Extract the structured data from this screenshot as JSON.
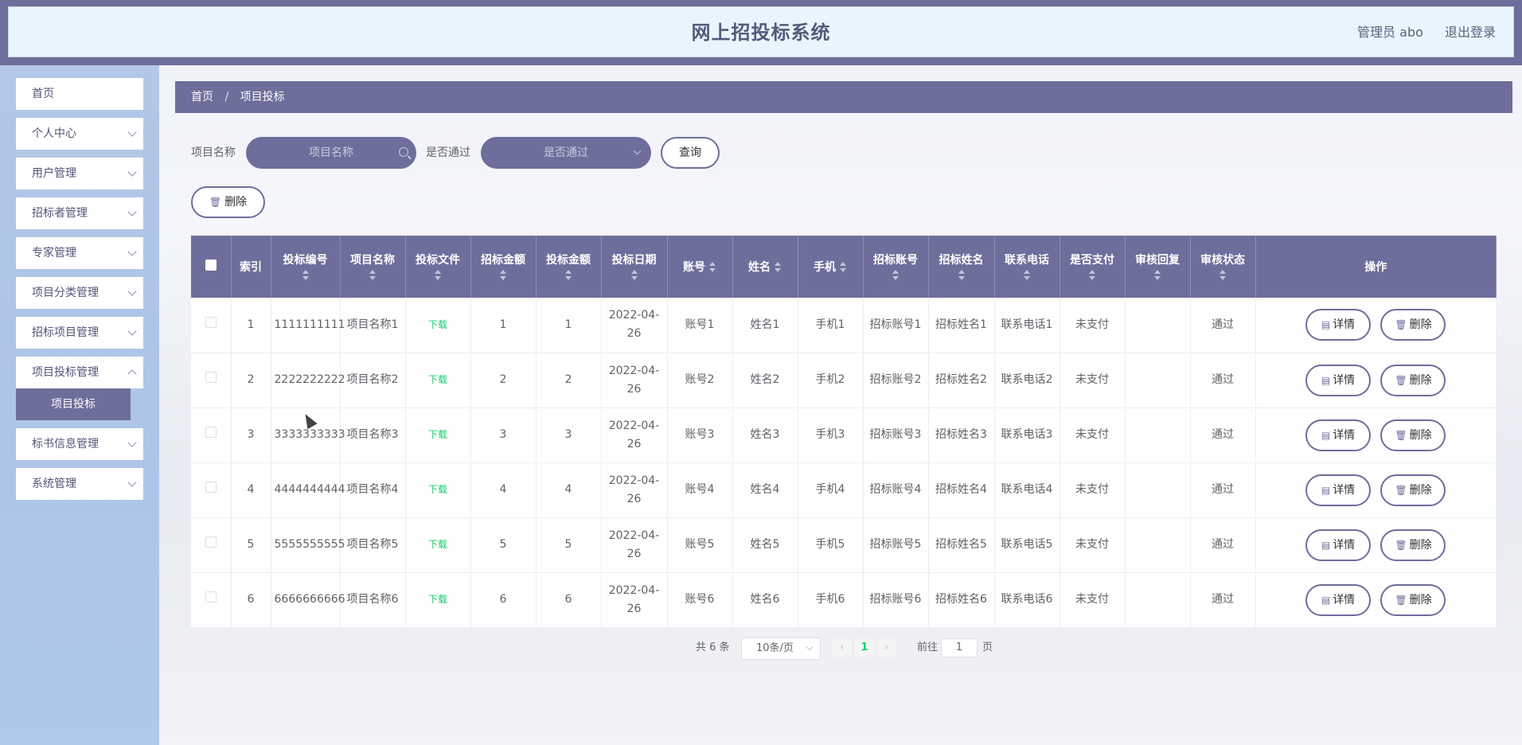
{
  "header": {
    "title": "网上招投标系统",
    "admin": "管理员 abo",
    "logout": "退出登录"
  },
  "sidebar": {
    "items": [
      {
        "label": "首页",
        "has_chevron": false
      },
      {
        "label": "个人中心",
        "has_chevron": true
      },
      {
        "label": "用户管理",
        "has_chevron": true
      },
      {
        "label": "招标者管理",
        "has_chevron": true
      },
      {
        "label": "专家管理",
        "has_chevron": true
      },
      {
        "label": "项目分类管理",
        "has_chevron": true
      },
      {
        "label": "招标项目管理",
        "has_chevron": true
      },
      {
        "label": "项目投标管理",
        "has_chevron": true,
        "expanded": true
      },
      {
        "label": "标书信息管理",
        "has_chevron": true
      },
      {
        "label": "系统管理",
        "has_chevron": true
      }
    ],
    "active_sub": "项目投标"
  },
  "breadcrumb": {
    "home": "首页",
    "sep": "/",
    "current": "项目投标"
  },
  "search": {
    "name_label": "项目名称",
    "name_placeholder": "项目名称",
    "pass_label": "是否通过",
    "pass_placeholder": "是否通过",
    "query_button": "查询"
  },
  "toolbar": {
    "delete_label": "删除"
  },
  "table": {
    "headers": [
      "索引",
      "投标编号",
      "项目名称",
      "投标文件",
      "招标金额",
      "投标金额",
      "投标日期",
      "账号",
      "姓名",
      "手机",
      "招标账号",
      "招标姓名",
      "联系电话",
      "是否支付",
      "审核回复",
      "审核状态",
      "操作"
    ],
    "rows": [
      {
        "idx": "1",
        "bid_no": "1111111111",
        "project": "项目名称1",
        "file": "下载",
        "tender_amt": "1",
        "bid_amt": "1",
        "date": "2022-04-26",
        "account": "账号1",
        "name": "姓名1",
        "phone": "手机1",
        "t_account": "招标账号1",
        "t_name": "招标姓名1",
        "contact": "联系电话1",
        "paid": "未支付",
        "reply": "",
        "status": "通过"
      },
      {
        "idx": "2",
        "bid_no": "2222222222",
        "project": "项目名称2",
        "file": "下载",
        "tender_amt": "2",
        "bid_amt": "2",
        "date": "2022-04-26",
        "account": "账号2",
        "name": "姓名2",
        "phone": "手机2",
        "t_account": "招标账号2",
        "t_name": "招标姓名2",
        "contact": "联系电话2",
        "paid": "未支付",
        "reply": "",
        "status": "通过"
      },
      {
        "idx": "3",
        "bid_no": "3333333333",
        "project": "项目名称3",
        "file": "下载",
        "tender_amt": "3",
        "bid_amt": "3",
        "date": "2022-04-26",
        "account": "账号3",
        "name": "姓名3",
        "phone": "手机3",
        "t_account": "招标账号3",
        "t_name": "招标姓名3",
        "contact": "联系电话3",
        "paid": "未支付",
        "reply": "",
        "status": "通过"
      },
      {
        "idx": "4",
        "bid_no": "4444444444",
        "project": "项目名称4",
        "file": "下载",
        "tender_amt": "4",
        "bid_amt": "4",
        "date": "2022-04-26",
        "account": "账号4",
        "name": "姓名4",
        "phone": "手机4",
        "t_account": "招标账号4",
        "t_name": "招标姓名4",
        "contact": "联系电话4",
        "paid": "未支付",
        "reply": "",
        "status": "通过"
      },
      {
        "idx": "5",
        "bid_no": "5555555555",
        "project": "项目名称5",
        "file": "下载",
        "tender_amt": "5",
        "bid_amt": "5",
        "date": "2022-04-26",
        "account": "账号5",
        "name": "姓名5",
        "phone": "手机5",
        "t_account": "招标账号5",
        "t_name": "招标姓名5",
        "contact": "联系电话5",
        "paid": "未支付",
        "reply": "",
        "status": "通过"
      },
      {
        "idx": "6",
        "bid_no": "6666666666",
        "project": "项目名称6",
        "file": "下载",
        "tender_amt": "6",
        "bid_amt": "6",
        "date": "2022-04-26",
        "account": "账号6",
        "name": "姓名6",
        "phone": "手机6",
        "t_account": "招标账号6",
        "t_name": "招标姓名6",
        "contact": "联系电话6",
        "paid": "未支付",
        "reply": "",
        "status": "通过"
      }
    ],
    "row_actions": {
      "detail": "详情",
      "delete": "删除"
    }
  },
  "pagination": {
    "total": "共 6 条",
    "page_size": "10条/页",
    "current_page": "1",
    "goto_label": "前往",
    "goto_value": "1",
    "page_suffix": "页"
  },
  "colors": {
    "accent": "#6d6e9b",
    "header_bg": "#e9f5fe",
    "sidebar_bg": "#b3c8e6",
    "link_green": "#13ce66"
  }
}
